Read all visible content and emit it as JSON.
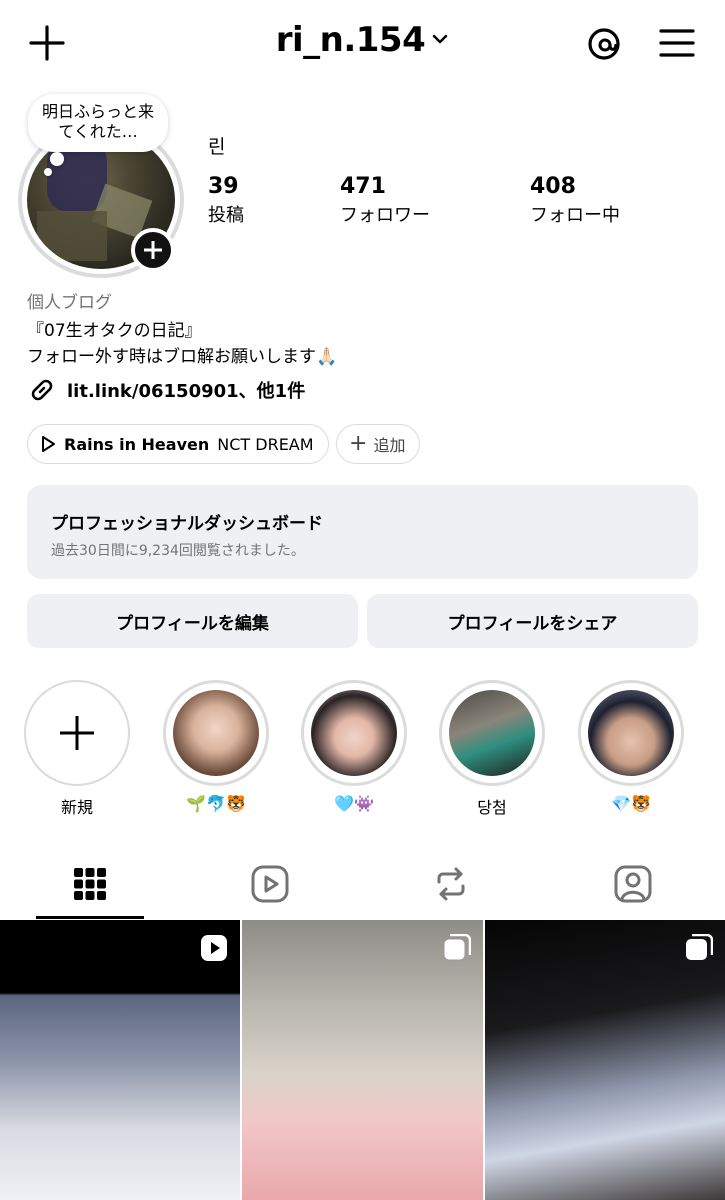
{
  "header": {
    "username": "ri_n.154",
    "icons": [
      "plus-icon",
      "chevron-down-icon",
      "threads-icon",
      "menu-icon"
    ]
  },
  "profile": {
    "note": "明日ふらっと来てくれた…",
    "display_name": "린",
    "stats": [
      {
        "num": "39",
        "label": "投稿"
      },
      {
        "num": "471",
        "label": "フォロワー"
      },
      {
        "num": "408",
        "label": "フォロー中"
      }
    ],
    "category": "個人ブログ",
    "bio_line1": "『07生オタクの日記』",
    "bio_line2": "フォロー外す時はブロ解お願いします🙏🏻",
    "link": "lit.link/06150901、他1件"
  },
  "music": {
    "title": "Rains in Heaven",
    "artist": "NCT DREAM",
    "add_label": "追加"
  },
  "dashboard": {
    "title": "プロフェッショナルダッシュボード",
    "subtitle": "過去30日間に9,234回閲覧されました。"
  },
  "actions": {
    "edit": "プロフィールを編集",
    "share": "プロフィールをシェア"
  },
  "highlights": [
    {
      "label": "新規"
    },
    {
      "label": "🌱🐬🐯"
    },
    {
      "label": "🩵👾"
    },
    {
      "label": "당첨"
    },
    {
      "label": "💎🐯"
    }
  ],
  "tabs": [
    "grid-icon",
    "reels-icon",
    "reposts-icon",
    "tagged-icon"
  ],
  "colors": {
    "background": "#ffffff",
    "secondary_surface": "#eff0f3",
    "muted_text": "#737373",
    "ring": "#dbdbdb"
  }
}
